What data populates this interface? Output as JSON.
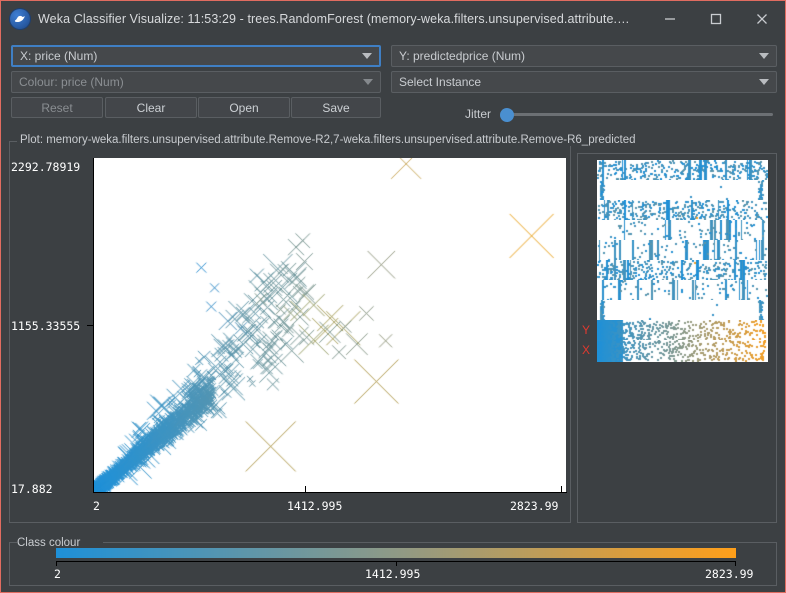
{
  "window": {
    "title": "Weka Classifier Visualize: 11:53:29 - trees.RandomForest (memory-weka.filters.unsupervised.attribute.Remove-R2,7-...",
    "icon": "weka-bird-icon",
    "minimize_label": "minimize-icon",
    "maximize_label": "maximize-icon",
    "close_label": "close-icon",
    "accent_border": "#e06c60",
    "background": "#3c4043"
  },
  "controls": {
    "x_axis_select": "X: price (Num)",
    "y_axis_select": "Y: predictedprice (Num)",
    "colour_select": "Colour: price (Num)",
    "instance_select": "Select Instance",
    "buttons": [
      {
        "label": "Reset",
        "enabled": false
      },
      {
        "label": "Clear",
        "enabled": true
      },
      {
        "label": "Open",
        "enabled": true
      },
      {
        "label": "Save",
        "enabled": true
      }
    ],
    "jitter_label": "Jitter",
    "jitter_value": 0
  },
  "plot": {
    "group_label": "Plot: memory-weka.filters.unsupervised.attribute.Remove-R2,7-weka.filters.unsupervised.attribute.Remove-R6_predicted"
  },
  "attribute_strips": {
    "y_marker": "Y",
    "x_marker": "X",
    "count": 10
  },
  "class_colour": {
    "group_label": "Class colour",
    "min_label": "2",
    "mid_label": "1412.995",
    "max_label": "2823.99",
    "gradient_start": "#1e90d8",
    "gradient_mid": "#8f9a86",
    "gradient_end": "#ff9f1a"
  },
  "chart_data": {
    "type": "scatter",
    "title": "Plot: memory-weka.filters.unsupervised.attribute.Remove-R2,7-weka.filters.unsupervised.attribute.Remove-R6_predicted",
    "xlabel": "price",
    "ylabel": "predictedprice",
    "xlim": [
      2,
      2823.99
    ],
    "ylim": [
      17.882,
      2292.78919
    ],
    "xticks": [
      "2",
      "1412.995",
      "2823.99"
    ],
    "yticks": [
      "17.882",
      "1155.33555",
      "2292.78919"
    ],
    "grid": false,
    "marker": "x",
    "colormap": [
      "#1e90d8",
      "#8f9a86",
      "#ff9f1a"
    ],
    "colorbar": {
      "min": 2,
      "mid": 1412.995,
      "max": 2823.99,
      "label": "Class colour"
    },
    "description": "Dense cluster of low-price instances near origin along the y=x diagonal, sparse high-value outliers in olive and orange",
    "points": [
      {
        "x": 2640,
        "y": 1780,
        "c": "#e8a11c",
        "s": 44
      },
      {
        "x": 1880,
        "y": 2280,
        "c": "#c9a85a",
        "s": 30
      },
      {
        "x": 1700,
        "y": 770,
        "c": "#b09a4e",
        "s": 44
      },
      {
        "x": 1060,
        "y": 320,
        "c": "#b09a4e",
        "s": 50
      },
      {
        "x": 1420,
        "y": 1210,
        "c": "#a8a05e",
        "s": 26
      },
      {
        "x": 1500,
        "y": 1140,
        "c": "#a8a05e",
        "s": 34
      },
      {
        "x": 1320,
        "y": 1300,
        "c": "#9aa06a",
        "s": 22
      },
      {
        "x": 1240,
        "y": 1260,
        "c": "#9aa06a",
        "s": 20
      },
      {
        "x": 1180,
        "y": 1245,
        "c": "#8a9a78",
        "s": 14
      },
      {
        "x": 1390,
        "y": 1120,
        "c": "#a8a05e",
        "s": 26
      },
      {
        "x": 1000,
        "y": 1340,
        "c": "#7d9688",
        "s": 12
      },
      {
        "x": 1120,
        "y": 1270,
        "c": "#7d9688",
        "s": 10
      },
      {
        "x": 1320,
        "y": 1060,
        "c": "#9aa06a",
        "s": 30
      },
      {
        "x": 800,
        "y": 1190,
        "c": "#4f93b8",
        "s": 18
      },
      {
        "x": 700,
        "y": 1290,
        "c": "#3a8fc8",
        "s": 10
      },
      {
        "x": 880,
        "y": 1140,
        "c": "#4f93b8",
        "s": 12
      },
      {
        "x": 640,
        "y": 1560,
        "c": "#2f8fd0",
        "s": 10
      },
      {
        "x": 720,
        "y": 1420,
        "c": "#3a8fc8",
        "s": 9
      }
    ]
  }
}
